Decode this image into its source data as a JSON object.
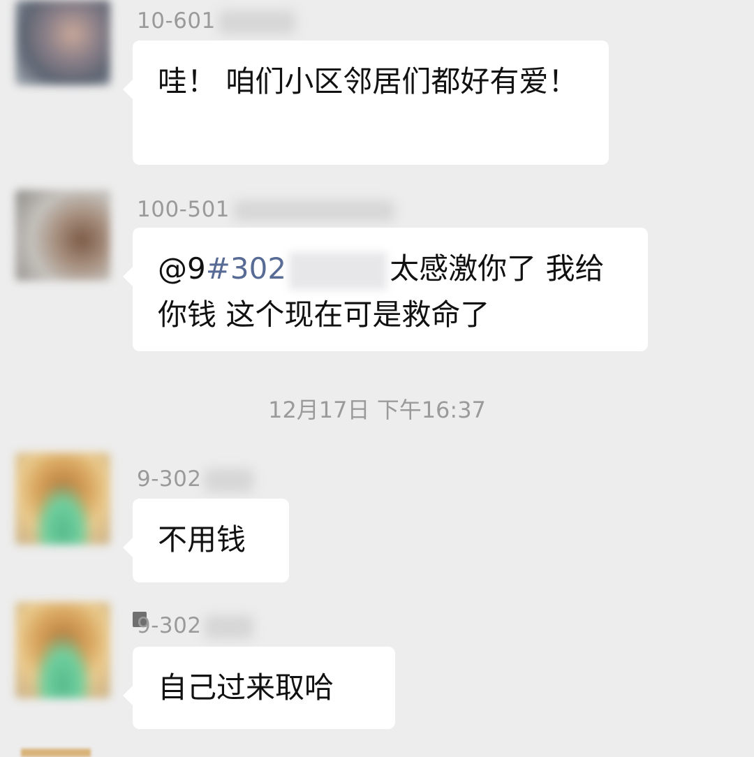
{
  "messages": [
    {
      "sender": "10-601",
      "avatar_icon": "avatar-icon",
      "text": "哇！ 咱们小区邻居们都好有爱！"
    },
    {
      "sender": "100-501",
      "avatar_icon": "avatar-icon",
      "mention_prefix": "@9",
      "mention_highlight": "#302",
      "text": "太感激你了 我给你钱 这个现在可是救命了"
    },
    {
      "sender": "9-302",
      "avatar_icon": "avatar-icon",
      "text": "不用钱"
    },
    {
      "sender": "9-302",
      "avatar_icon": "avatar-icon",
      "text": "自己过来取哈"
    }
  ],
  "timestamp": "12月17日 下午16:37",
  "colors": {
    "background": "#ededed",
    "bubble": "#ffffff",
    "mention": "#576b95",
    "meta_text": "#9a9a9a"
  }
}
